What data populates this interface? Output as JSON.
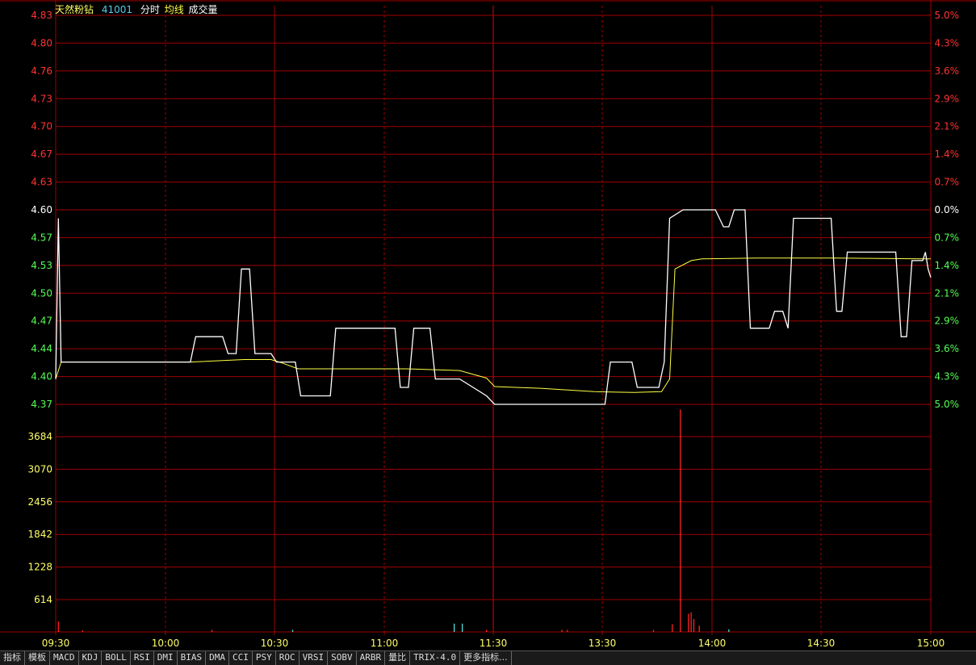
{
  "title": {
    "name": "天然粉钻",
    "code": "41001",
    "legend_time": "分时",
    "legend_avg": "均线",
    "legend_vol": "成交量"
  },
  "colors": {
    "background": "#000000",
    "grid": "#a00000",
    "price_line": "#ffffff",
    "avg_line": "#ffff44",
    "up": "#ff3333",
    "down": "#55ff55",
    "neutral": "#ffffff",
    "volume_up": "#ff2222",
    "volume_flat": "#55dddd",
    "volume_label": "#ffff66"
  },
  "tabs": [
    "指标",
    "模板",
    "MACD",
    "KDJ",
    "BOLL",
    "RSI",
    "DMI",
    "BIAS",
    "DMA",
    "CCI",
    "PSY",
    "ROC",
    "VRSI",
    "SOBV",
    "ARBR",
    "量比",
    "TRIX-4.0",
    "更多指标..."
  ],
  "chart_data": [
    {
      "type": "line",
      "prev_close": 4.6,
      "y_left_ticks": [
        "4.83",
        "4.80",
        "4.76",
        "4.73",
        "4.70",
        "4.67",
        "4.63",
        "4.60",
        "4.57",
        "4.53",
        "4.50",
        "4.47",
        "4.44",
        "4.40",
        "4.37"
      ],
      "y_right_ticks": [
        "5.0%",
        "4.3%",
        "3.6%",
        "2.9%",
        "2.1%",
        "1.4%",
        "0.7%",
        "0.0%",
        "0.7%",
        "1.4%",
        "2.1%",
        "2.9%",
        "3.6%",
        "4.3%",
        "5.0%"
      ],
      "x_ticks": [
        "09:30",
        "10:00",
        "10:30",
        "11:00",
        "11:30",
        "13:30",
        "14:00",
        "14:30",
        "15:00"
      ],
      "ylim": [
        4.37,
        4.83
      ],
      "series": [
        {
          "kind": "price",
          "points": [
            [
              0,
              4.4
            ],
            [
              1,
              4.59
            ],
            [
              2,
              4.42
            ],
            [
              50,
              4.42
            ],
            [
              52,
              4.45
            ],
            [
              62,
              4.45
            ],
            [
              64,
              4.43
            ],
            [
              67,
              4.43
            ],
            [
              69,
              4.53
            ],
            [
              72,
              4.53
            ],
            [
              74,
              4.43
            ],
            [
              80,
              4.43
            ],
            [
              82,
              4.42
            ],
            [
              89,
              4.42
            ],
            [
              91,
              4.38
            ],
            [
              102,
              4.38
            ],
            [
              104,
              4.46
            ],
            [
              126,
              4.46
            ],
            [
              128,
              4.39
            ],
            [
              131,
              4.39
            ],
            [
              133,
              4.46
            ],
            [
              139,
              4.46
            ],
            [
              141,
              4.4
            ],
            [
              150,
              4.4
            ],
            [
              155,
              4.39
            ],
            [
              160,
              4.38
            ],
            [
              163,
              4.37
            ],
            [
              204,
              4.37
            ],
            [
              206,
              4.42
            ],
            [
              214,
              4.42
            ],
            [
              216,
              4.39
            ],
            [
              224,
              4.39
            ],
            [
              226,
              4.42
            ],
            [
              228,
              4.59
            ],
            [
              233,
              4.6
            ],
            [
              245,
              4.6
            ],
            [
              248,
              4.58
            ],
            [
              250,
              4.58
            ],
            [
              252,
              4.6
            ],
            [
              256,
              4.6
            ],
            [
              258,
              4.46
            ],
            [
              265,
              4.46
            ],
            [
              267,
              4.48
            ],
            [
              270,
              4.48
            ],
            [
              272,
              4.46
            ],
            [
              274,
              4.59
            ],
            [
              288,
              4.59
            ],
            [
              290,
              4.48
            ],
            [
              292,
              4.48
            ],
            [
              294,
              4.55
            ],
            [
              312,
              4.55
            ],
            [
              314,
              4.45
            ],
            [
              316,
              4.45
            ],
            [
              318,
              4.54
            ],
            [
              322,
              4.54
            ],
            [
              323,
              4.55
            ],
            [
              324,
              4.53
            ],
            [
              325,
              4.52
            ]
          ]
        },
        {
          "kind": "avg",
          "points": [
            [
              0,
              4.4
            ],
            [
              2,
              4.42
            ],
            [
              50,
              4.42
            ],
            [
              70,
              4.423
            ],
            [
              80,
              4.423
            ],
            [
              84,
              4.419
            ],
            [
              90,
              4.412
            ],
            [
              130,
              4.412
            ],
            [
              150,
              4.41
            ],
            [
              160,
              4.401
            ],
            [
              163,
              4.391
            ],
            [
              180,
              4.389
            ],
            [
              200,
              4.385
            ],
            [
              215,
              4.384
            ],
            [
              225,
              4.385
            ],
            [
              228,
              4.4
            ],
            [
              230,
              4.53
            ],
            [
              236,
              4.54
            ],
            [
              240,
              4.542
            ],
            [
              260,
              4.543
            ],
            [
              290,
              4.543
            ],
            [
              325,
              4.542
            ]
          ]
        }
      ]
    },
    {
      "type": "bar",
      "y_left_ticks": [
        "3684",
        "3070",
        "2456",
        "1842",
        "1228",
        "614"
      ],
      "ylim": [
        0,
        4400
      ],
      "bars": [
        {
          "t": 1,
          "v": 200,
          "c": "up"
        },
        {
          "t": 10,
          "v": 30,
          "c": "up"
        },
        {
          "t": 58,
          "v": 40,
          "c": "up"
        },
        {
          "t": 88,
          "v": 40,
          "c": "flat"
        },
        {
          "t": 148,
          "v": 160,
          "c": "flat"
        },
        {
          "t": 151,
          "v": 160,
          "c": "flat"
        },
        {
          "t": 160,
          "v": 40,
          "c": "up"
        },
        {
          "t": 188,
          "v": 40,
          "c": "up"
        },
        {
          "t": 190,
          "v": 40,
          "c": "up"
        },
        {
          "t": 222,
          "v": 40,
          "c": "up"
        },
        {
          "t": 229,
          "v": 150,
          "c": "up"
        },
        {
          "t": 232,
          "v": 4300,
          "c": "up"
        },
        {
          "t": 235,
          "v": 350,
          "c": "up"
        },
        {
          "t": 236,
          "v": 380,
          "c": "up"
        },
        {
          "t": 237,
          "v": 250,
          "c": "up"
        },
        {
          "t": 239,
          "v": 120,
          "c": "up"
        },
        {
          "t": 250,
          "v": 50,
          "c": "flat"
        }
      ]
    }
  ]
}
